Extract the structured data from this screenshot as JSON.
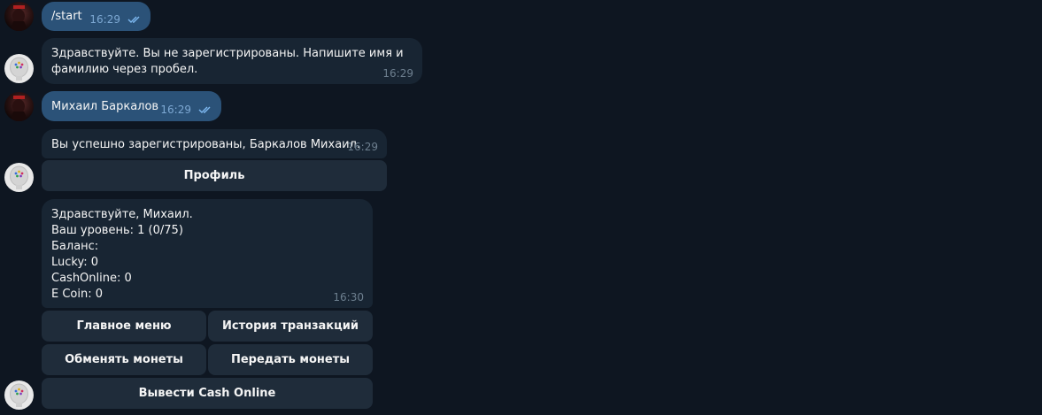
{
  "messages": {
    "m1": {
      "text": "/start",
      "time": "16:29"
    },
    "m2": {
      "line1": "Здравствуйте. Вы не зарегистрированы. Напишите имя и",
      "line2": "фамилию через пробел.",
      "time": "16:29"
    },
    "m3": {
      "text": "Михаил Баркалов",
      "time": "16:29"
    },
    "m4": {
      "text": "Вы успешно зарегистрированы, Барkaлов Михаил.",
      "time": "16:29"
    },
    "m5": {
      "lines": [
        "Здравствуйте, Михаил.",
        "Ваш уровень: 1 (0/75)",
        "Баланс:",
        "Lucky: 0",
        "CashOnline: 0",
        "E Coin: 0"
      ],
      "time": "16:30"
    }
  },
  "keyboard1": {
    "profile": "Профиль"
  },
  "keyboard2": {
    "main_menu": "Главное меню",
    "history": "История транзакций",
    "exchange": "Обменять монеты",
    "transfer": "Передать монеты",
    "withdraw": "Вывести Cash Online"
  },
  "icons": {
    "read_receipt": "double-check-icon",
    "user_avatar": "user-avatar",
    "bot_avatar": "bot-avatar"
  }
}
